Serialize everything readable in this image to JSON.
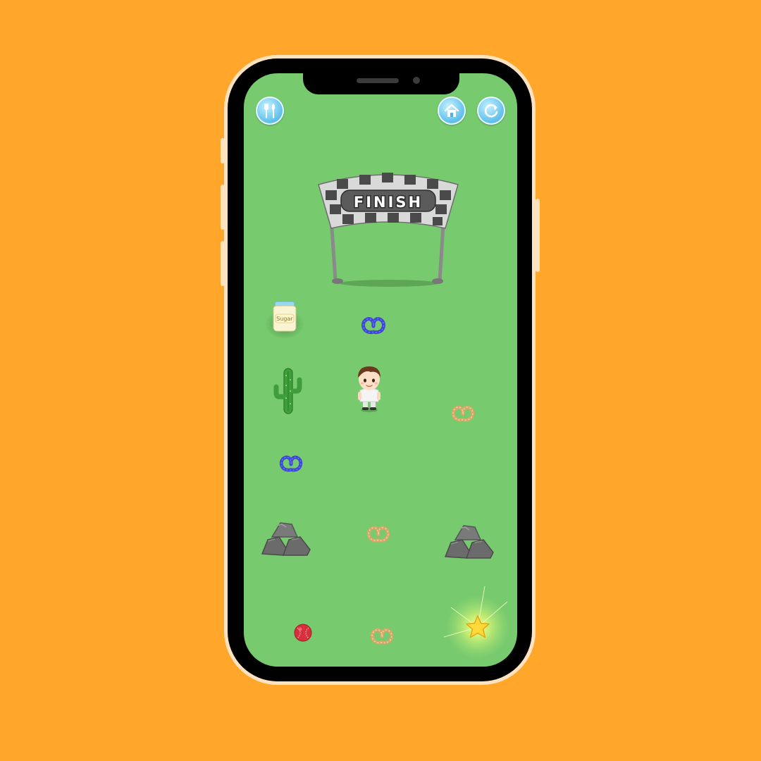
{
  "game": {
    "finish_banner": "FINISH",
    "jar_label": "Sugar"
  },
  "hud": {
    "left_button_icon": "utensils-icon",
    "home_button_icon": "home-icon",
    "restart_button_icon": "restart-icon"
  },
  "colors": {
    "background": "#FFA62B",
    "grass": "#78CA6E",
    "phone_frame": "#FFE2BF",
    "hud_button": "#6cc6ee"
  }
}
